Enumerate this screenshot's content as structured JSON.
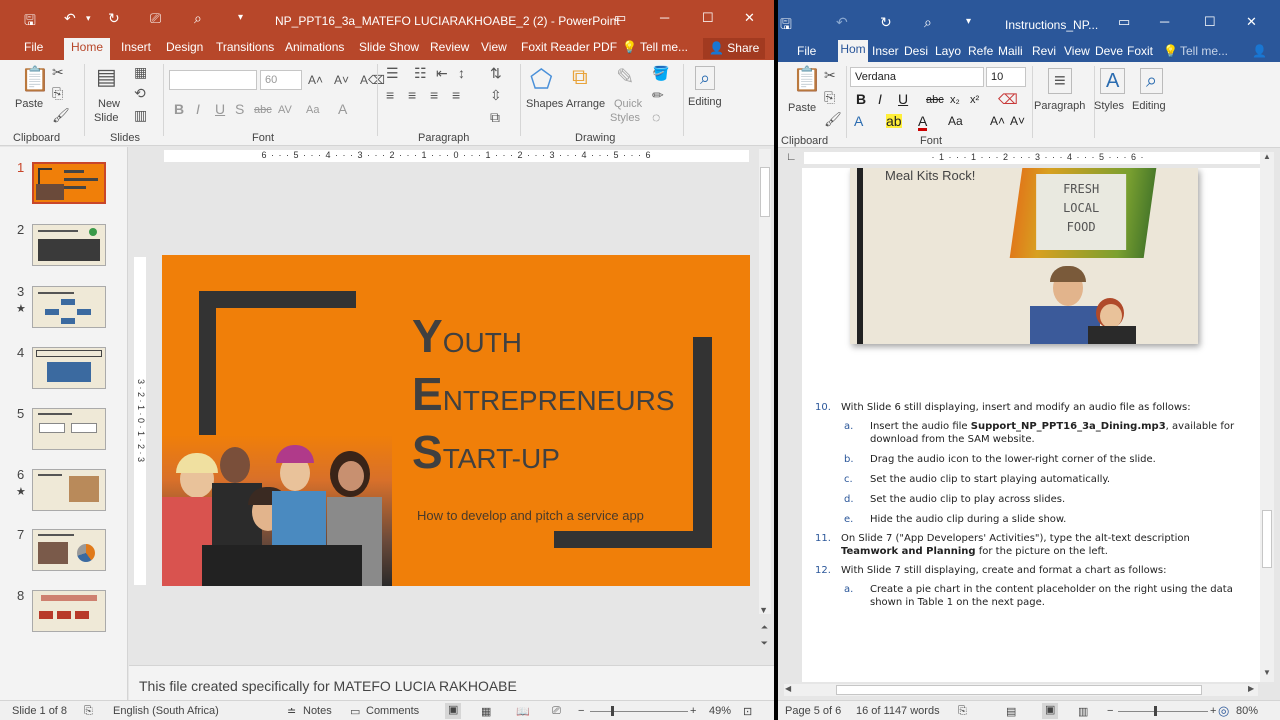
{
  "powerpoint": {
    "title": "NP_PPT16_3a_MATEFO LUCIARAKHOABE_2 (2) - PowerPoint",
    "tabs": [
      "File",
      "Home",
      "Insert",
      "Design",
      "Transitions",
      "Animations",
      "Slide Show",
      "Review",
      "View",
      "Foxit Reader PDF"
    ],
    "tell_me": "Tell me...",
    "share": "Share",
    "ribbon": {
      "paste": "Paste",
      "new_slide": "New",
      "new_slide2": "Slide",
      "font_size": "60",
      "shapes": "Shapes",
      "arrange": "Arrange",
      "quick": "Quick",
      "styles": "Styles",
      "editing": "Editing",
      "groups": [
        "Clipboard",
        "Slides",
        "Font",
        "Paragraph",
        "Drawing"
      ]
    },
    "ruler_text": "6 · · · 5 · · · 4 · · · 3 · · · 2 · · · 1 · · · 0 · · · 1 · · · 2 · · · 3 · · · 4 · · · 5 · · · 6",
    "vruler_text": "3 · 2 · 1 · 0 · 1 · 2 · 3",
    "thumbnails": [
      {
        "num": "1",
        "title": "Youth Entrepreneurs Start-up",
        "star": ""
      },
      {
        "num": "2",
        "title": "Rapid Growth of Services Industry",
        "star": ""
      },
      {
        "num": "3",
        "title": "Paying for Services",
        "star": "★"
      },
      {
        "num": "4",
        "title": "On-Demand Mobile Services",
        "star": ""
      },
      {
        "num": "5",
        "title": "What Kind of Services?",
        "star": ""
      },
      {
        "num": "6",
        "title": "Food Prep Services",
        "star": "★"
      },
      {
        "num": "7",
        "title": "App Developers' Activities",
        "star": ""
      },
      {
        "num": "8",
        "title": "How Do You Make a Profit?",
        "star": ""
      }
    ],
    "slide": {
      "line1_big": "Y",
      "line1_rest": "OUTH",
      "line2_big": "E",
      "line2_rest": "NTREPRENEURS",
      "line3_big": "S",
      "line3_rest": "TART-UP",
      "subtitle": "How to develop and pitch a service app",
      "bg": "#f07f09"
    },
    "notes": "This file created specifically for MATEFO LUCIA RAKHOABE",
    "status": {
      "slide": "Slide 1 of 8",
      "lang": "English (South Africa)",
      "notes": "Notes",
      "comments": "Comments",
      "zoom": "49%"
    }
  },
  "word": {
    "title": "Instructions_NP...",
    "tabs": [
      "File",
      "Hom",
      "Inser",
      "Desi",
      "Layo",
      "Refe",
      "Maili",
      "Revi",
      "View",
      "Deve",
      "Foxit"
    ],
    "tell_me": "Tell me...",
    "font": "Verdana",
    "size": "10",
    "ribbon": {
      "paste": "Paste",
      "paragraph": "Paragraph",
      "styles": "Styles",
      "editing": "Editing",
      "groups": [
        "Clipboard",
        "Font"
      ]
    },
    "ruler_text": "· 1 · · · 1 · · · 2 · · · 3 · · · 4 · · · 5 · · · 6 ·",
    "image": {
      "caption": "Meal Kits Rock!",
      "sign1": "FRESH",
      "sign2": "LOCAL",
      "sign3": "FOOD"
    },
    "steps": [
      {
        "num": "10.",
        "text": "With Slide 6 still displaying, insert and modify an audio file as follows:",
        "sub": [
          {
            "l": "a.",
            "pre": "Insert the audio file ",
            "bold": "Support_NP_PPT16_3a_Dining.mp3",
            "post": ", available for download from the SAM website."
          },
          {
            "l": "b.",
            "pre": "Drag the audio icon to the lower-right corner of the slide.",
            "bold": "",
            "post": ""
          },
          {
            "l": "c.",
            "pre": "Set the audio clip to start playing automatically.",
            "bold": "",
            "post": ""
          },
          {
            "l": "d.",
            "pre": "Set the audio clip to play across slides.",
            "bold": "",
            "post": ""
          },
          {
            "l": "e.",
            "pre": "Hide the audio clip during a slide show.",
            "bold": "",
            "post": ""
          }
        ]
      },
      {
        "num": "11.",
        "text": "On Slide 7 (\"App Developers' Activities\"), type the alt-text description",
        "bold": "Teamwork and Planning",
        "post": " for the picture on the left."
      },
      {
        "num": "12.",
        "text": "With Slide 7 still displaying, create and format a chart as follows:",
        "sub": [
          {
            "l": "a.",
            "pre": "Create a pie chart in the content placeholder on the right using the data shown in Table 1 on the next page.",
            "bold": "",
            "post": ""
          }
        ]
      }
    ],
    "status": {
      "page": "Page 5 of 6",
      "words": "16 of 1147 words",
      "zoom": "80%"
    }
  }
}
